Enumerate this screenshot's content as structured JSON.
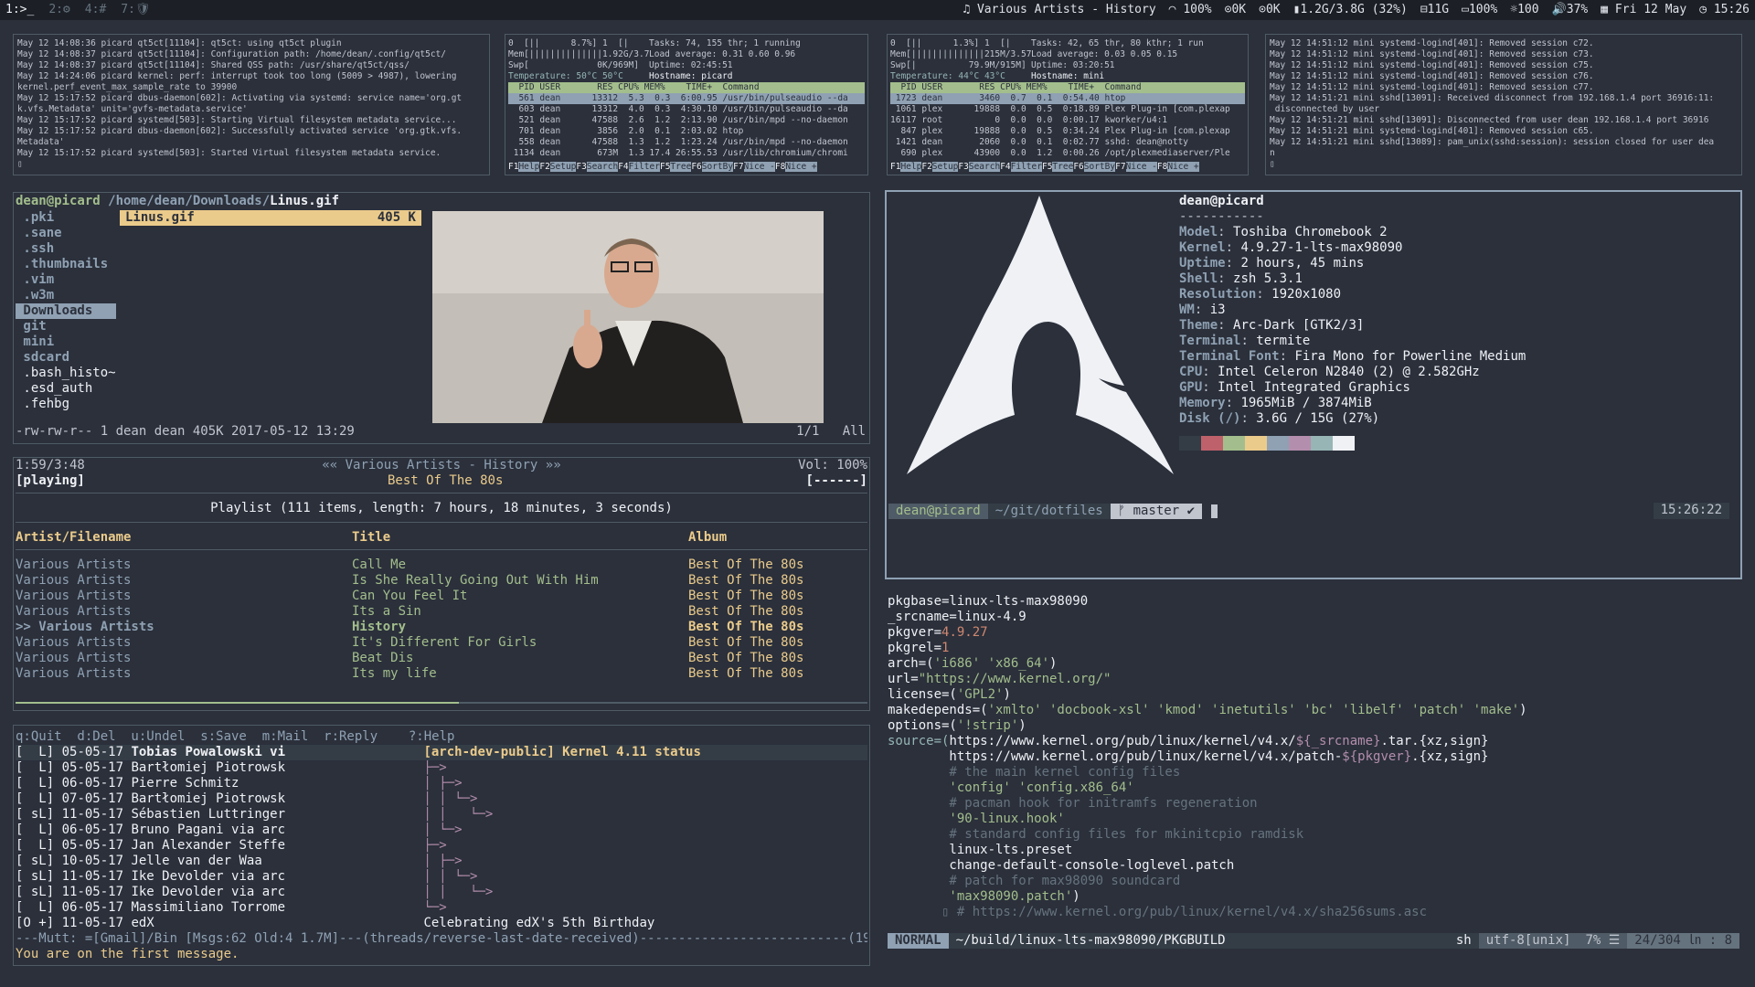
{
  "bar": {
    "workspaces": [
      "1:>_",
      "2:⚙",
      "4:#",
      "7:🛡"
    ],
    "active_workspace": 0,
    "status": [
      "Various Artists - History",
      "100%",
      "0K",
      "0K",
      "1.2G/3.8G (32%)",
      "11G",
      "100%",
      "100",
      "37%",
      "Fri 12 May",
      "15:26"
    ]
  },
  "log1": [
    "May 12 14:08:36 picard qt5ct[11104]: qt5ct: using qt5ct plugin",
    "May 12 14:08:37 picard qt5ct[11104]: Configuration path: /home/dean/.config/qt5ct/",
    "May 12 14:08:37 picard qt5ct[11104]: Shared QSS path: /usr/share/qt5ct/qss/",
    "May 12 14:24:06 picard kernel: perf: interrupt took too long (5009 > 4987), lowering",
    "kernel.perf_event_max_sample_rate to 39900",
    "May 12 15:17:52 picard dbus-daemon[602]: Activating via systemd: service name='org.gt",
    "k.vfs.Metadata' unit='gvfs-metadata.service'",
    "May 12 15:17:52 picard systemd[503]: Starting Virtual filesystem metadata service...",
    "May 12 15:17:52 picard dbus-daemon[602]: Successfully activated service 'org.gtk.vfs.",
    "Metadata'",
    "May 12 15:17:52 picard systemd[503]: Started Virtual filesystem metadata service.",
    "▯"
  ],
  "htop1": {
    "cpu0": "0  [||      8.7%] 1  [|       8.5%]",
    "tasks": "Tasks: 74, 155 thr; 1 running",
    "mem": "Mem[||||||||||||||1.92G/3.78G]",
    "load": "Load average: 0.31 0.60 0.96",
    "swp": "Swp[             0K/969M]",
    "uptime": "Uptime: 02:45:51",
    "temp": "Temperature: 50°C 50°C",
    "host": "Hostname: picard",
    "header": "  PID USER       RES CPU% MEM%    TIME+  Command",
    "rows": [
      "  561 dean      13312  5.3  0.3  6:00.95 /usr/bin/pulseaudio --da",
      "  603 dean      13312  4.0  0.3  4:30.10 /usr/bin/pulseaudio --da",
      "  521 dean      47588  2.6  1.2  2:13.90 /usr/bin/mpd --no-daemon",
      "  701 dean       3856  2.0  0.1  2:03.02 htop",
      "  558 dean      47588  1.3  1.2  1:23.24 /usr/bin/mpd --no-daemon",
      " 1134 dean       673M  1.3 17.4 26:55.53 /usr/lib/chromium/chromi"
    ],
    "keys": [
      "F1",
      "Help",
      "F2",
      "Setup",
      "F3",
      "Search",
      "F4",
      "Filter",
      "F5",
      "Tree",
      "F6",
      "SortBy",
      "F7",
      "Nice -",
      "F8",
      "Nice +"
    ]
  },
  "htop2": {
    "cpu0": "0  [||      1.3%] 1  [|       1.3%]",
    "tasks": "Tasks: 42, 65 thr, 80 kthr; 1 run",
    "mem": "Mem[||||||||||||||215M/3.57G]",
    "load": "Load average: 0.03 0.05 0.15",
    "swp": "Swp[|          79.9M/915M]",
    "uptime": "Uptime: 03:20:51",
    "temp": "Temperature: 44°C 43°C",
    "host": "Hostname: mini",
    "header": "  PID USER       RES CPU% MEM%    TIME+  Command",
    "rows": [
      " 1723 dean       3460  0.7  0.1  0:54.40 htop",
      " 1061 plex      19888  0.0  0.5  0:18.89 Plex Plug-in [com.plexap",
      "16117 root          0  0.0  0.0  0:00.17 kworker/u4:1",
      "  847 plex      19888  0.0  0.5  0:34.24 Plex Plug-in [com.plexap",
      " 1421 dean       2060  0.0  0.1  0:02.77 sshd: dean@notty",
      "  690 plex      43900  0.0  1.2  0:00.26 /opt/plexmediaserver/Ple"
    ],
    "keys": [
      "F1",
      "Help",
      "F2",
      "Setup",
      "F3",
      "Search",
      "F4",
      "Filter",
      "F5",
      "Tree",
      "F6",
      "SortBy",
      "F7",
      "Nice -",
      "F8",
      "Nice +"
    ]
  },
  "log2": [
    "May 12 14:51:12 mini systemd-logind[401]: Removed session c72.",
    "May 12 14:51:12 mini systemd-logind[401]: Removed session c73.",
    "May 12 14:51:12 mini systemd-logind[401]: Removed session c75.",
    "May 12 14:51:12 mini systemd-logind[401]: Removed session c76.",
    "May 12 14:51:12 mini systemd-logind[401]: Removed session c77.",
    "May 12 14:51:21 mini sshd[13091]: Received disconnect from 192.168.1.4 port 36916:11:",
    " disconnected by user",
    "May 12 14:51:21 mini sshd[13091]: Disconnected from user dean 192.168.1.4 port 36916",
    "May 12 14:51:21 mini systemd-logind[401]: Removed session c65.",
    "May 12 14:51:21 mini sshd[13089]: pam_unix(sshd:session): session closed for user dea",
    "n",
    "▯"
  ],
  "ranger": {
    "user_host": "dean@picard",
    "path": " /home/dean/Downloads/",
    "file": "Linus.gif",
    "dirs": [
      ".pki",
      ".sane",
      ".ssh",
      ".thumbnails",
      ".vim",
      ".w3m",
      "Downloads",
      "git",
      "mini",
      "sdcard",
      ".bash_histo~",
      ".esd_auth",
      ".fehbg"
    ],
    "selected_dir": 6,
    "sel_file_name": "Linus.gif",
    "sel_file_size": "405 K",
    "status": "-rw-rw-r-- 1 dean dean 405K 2017-05-12 13:29",
    "status_right": "1/1   All"
  },
  "neofetch": {
    "title": "dean@picard",
    "rule": "-----------",
    "fields": [
      {
        "k": "Model",
        "v": "Toshiba Chromebook 2"
      },
      {
        "k": "Kernel",
        "v": "4.9.27-1-lts-max98090"
      },
      {
        "k": "Uptime",
        "v": "2 hours, 45 mins"
      },
      {
        "k": "Shell",
        "v": "zsh 5.3.1"
      },
      {
        "k": "Resolution",
        "v": "1920x1080"
      },
      {
        "k": "WM",
        "v": "i3"
      },
      {
        "k": "Theme",
        "v": "Arc-Dark [GTK2/3]"
      },
      {
        "k": "Terminal",
        "v": "termite"
      },
      {
        "k": "Terminal Font",
        "v": "Fira Mono for Powerline Medium"
      },
      {
        "k": "CPU",
        "v": "Intel Celeron N2840 (2) @ 2.582GHz"
      },
      {
        "k": "GPU",
        "v": "Intel Integrated Graphics"
      },
      {
        "k": "Memory",
        "v": "1965MiB / 3874MiB"
      },
      {
        "k": "Disk (/)",
        "v": "3.6G / 15G (27%)"
      }
    ],
    "colors": [
      "#343d46",
      "#bf616a",
      "#a3be8c",
      "#ebcb8b",
      "#8fa1b3",
      "#b48ead",
      "#96b5b4",
      "#eff1f5"
    ],
    "prompt_user": "dean@picard",
    "prompt_path": "~/git/dotfiles",
    "prompt_branch": "ᚠ master ✔",
    "prompt_time": "15:26:22"
  },
  "ncmpcpp": {
    "time": "1:59/3:48",
    "state": "[playing]",
    "title": "«« Various Artists - History »»",
    "album": "Best Of The 80s",
    "vol": "Vol: 100%",
    "flags": "[------]",
    "playlist": "Playlist (111 items, length: 7 hours, 18 minutes, 3 seconds)",
    "cols": [
      "Artist/Filename",
      "Title",
      "Album"
    ],
    "rows": [
      [
        "Various Artists",
        "Call Me",
        "Best Of The 80s"
      ],
      [
        "Various Artists",
        "Is She Really Going Out With Him",
        "Best Of The 80s"
      ],
      [
        "Various Artists",
        "Can You Feel It",
        "Best Of The 80s"
      ],
      [
        "Various Artists",
        "Its a Sin",
        "Best Of The 80s"
      ],
      [
        ">> Various Artists",
        "History",
        "Best Of The 80s"
      ],
      [
        "Various Artists",
        "It's Different For Girls",
        "Best Of The 80s"
      ],
      [
        "Various Artists",
        "Beat Dis",
        "Best Of The 80s"
      ],
      [
        "Various Artists",
        "Its my life",
        "Best Of The 80s"
      ]
    ],
    "current_index": 4,
    "progress_fraction": 0.52
  },
  "mutt": {
    "help": "q:Quit  d:Del  u:Undel  s:Save  m:Mail  r:Reply    ?:Help",
    "rows": [
      {
        "flags": "[  L]",
        "date": "05-05-17",
        "from": "Tobias Powalowski vi",
        "tree": "",
        "subj": "[arch-dev-public] Kernel 4.11 status",
        "current": true
      },
      {
        "flags": "[  L]",
        "date": "05-05-17",
        "from": "Bartłomiej Piotrowsk",
        "tree": "├─>",
        "subj": ""
      },
      {
        "flags": "[  L]",
        "date": "06-05-17",
        "from": "Pierre Schmitz",
        "tree": "│ ├─>",
        "subj": ""
      },
      {
        "flags": "[  L]",
        "date": "07-05-17",
        "from": "Bartłomiej Piotrowsk",
        "tree": "│ │ └─>",
        "subj": ""
      },
      {
        "flags": "[ sL]",
        "date": "11-05-17",
        "from": "Sébastien Luttringer",
        "tree": "│ │   └─>",
        "subj": ""
      },
      {
        "flags": "[  L]",
        "date": "06-05-17",
        "from": "Bruno Pagani via arc",
        "tree": "│ └─>",
        "subj": ""
      },
      {
        "flags": "[  L]",
        "date": "05-05-17",
        "from": "Jan Alexander Steffe",
        "tree": "├─>",
        "subj": ""
      },
      {
        "flags": "[ sL]",
        "date": "10-05-17",
        "from": "Jelle van der Waa",
        "tree": "│ ├─>",
        "subj": ""
      },
      {
        "flags": "[ sL]",
        "date": "11-05-17",
        "from": "Ike Devolder via arc",
        "tree": "│ │ └─>",
        "subj": ""
      },
      {
        "flags": "[ sL]",
        "date": "11-05-17",
        "from": "Ike Devolder via arc",
        "tree": "│ │   └─>",
        "subj": ""
      },
      {
        "flags": "[  L]",
        "date": "06-05-17",
        "from": "Massimiliano Torrome",
        "tree": "└─>",
        "subj": ""
      },
      {
        "flags": "[O +]",
        "date": "11-05-17",
        "from": "edX",
        "tree": "",
        "subj": "Celebrating edX's 5th Birthday"
      }
    ],
    "status": "---Mutt: =[Gmail]/Bin [Msgs:62 Old:4 1.7M]---(threads/reverse-last-date-received)---------------------------(19%)---",
    "message": "You are on the first message."
  },
  "vim": {
    "lines": [
      [
        [
          "pkgbase=linux-lts-max98090",
          "w"
        ]
      ],
      [
        [
          "_srcname=linux-4.9",
          "w"
        ]
      ],
      [
        [
          "pkgver=",
          "w"
        ],
        [
          "4.9.27",
          "o"
        ]
      ],
      [
        [
          "pkgrel=",
          "w"
        ],
        [
          "1",
          "o"
        ]
      ],
      [
        [
          "arch=(",
          "w"
        ],
        [
          "'i686' 'x86_64'",
          "g"
        ],
        [
          ")",
          "w"
        ]
      ],
      [
        [
          "url=",
          "w"
        ],
        [
          "\"https://www.kernel.org/\"",
          "g"
        ]
      ],
      [
        [
          "license=(",
          "w"
        ],
        [
          "'GPL2'",
          "g"
        ],
        [
          ")",
          "w"
        ]
      ],
      [
        [
          "makedepends=(",
          "w"
        ],
        [
          "'xmlto' 'docbook-xsl' 'kmod' 'inetutils' 'bc' 'libelf' 'patch' 'make'",
          "g"
        ],
        [
          ")",
          "w"
        ]
      ],
      [
        [
          "options=(",
          "w"
        ],
        [
          "'!strip'",
          "g"
        ],
        [
          ")",
          "w"
        ]
      ],
      [
        [
          "source=(",
          "c"
        ],
        [
          "https://www.kernel.org/pub/linux/kernel/v4.x/",
          "w"
        ],
        [
          "${_srcname}",
          "p"
        ],
        [
          ".tar.{xz,sign}",
          "w"
        ]
      ],
      [
        [
          "        https://www.kernel.org/pub/linux/kernel/v4.x/patch-",
          "w"
        ],
        [
          "${pkgver}",
          "p"
        ],
        [
          ".{xz,sign}",
          "w"
        ]
      ],
      [
        [
          "        # the main kernel config files",
          "m"
        ]
      ],
      [
        [
          "        'config' 'config.x86_64'",
          "g"
        ]
      ],
      [
        [
          "        # pacman hook for initramfs regeneration",
          "m"
        ]
      ],
      [
        [
          "        '90-linux.hook'",
          "g"
        ]
      ],
      [
        [
          "        # standard config files for mkinitcpio ramdisk",
          "m"
        ]
      ],
      [
        [
          "        linux-lts.preset",
          "w"
        ]
      ],
      [
        [
          "        change-default-console-loglevel.patch",
          "w"
        ]
      ],
      [
        [
          "        # patch for max98090 soundcard",
          "m"
        ]
      ],
      [
        [
          "        'max98090.patch'",
          "g"
        ],
        [
          ")",
          "w"
        ]
      ],
      [
        [
          "",
          "w"
        ]
      ],
      [
        [
          "       ▯ # https://www.kernel.org/pub/linux/kernel/v4.x/sha256sums.asc",
          "m"
        ]
      ]
    ],
    "mode": "NORMAL",
    "file": "~/build/linux-lts-max98090/PKGBUILD",
    "ft": "sh",
    "enc": "utf-8[unix]",
    "pct": "7% ☰",
    "pos": "24/304 ㏑ :  8"
  }
}
